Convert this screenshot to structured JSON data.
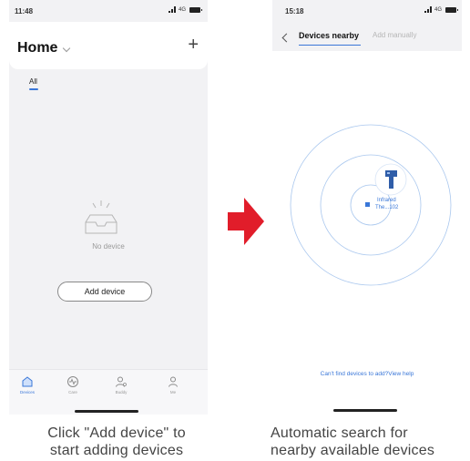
{
  "left_screen": {
    "status_bar": {
      "time": "11:48",
      "network": "4G"
    },
    "header": {
      "title": "Home",
      "add_label": "+"
    },
    "tabs": [
      {
        "label": "All"
      }
    ],
    "empty_state": {
      "text": "No device"
    },
    "add_button": {
      "label": "Add device"
    },
    "bottom_nav": [
      {
        "label": "Devices",
        "icon": "house-icon",
        "active": true
      },
      {
        "label": "Care",
        "icon": "wave-icon",
        "active": false
      },
      {
        "label": "Buddy",
        "icon": "buddy-icon",
        "active": false
      },
      {
        "label": "Me",
        "icon": "person-icon",
        "active": false
      }
    ]
  },
  "right_screen": {
    "status_bar": {
      "time": "15:18",
      "network": "4G"
    },
    "tabs": {
      "active": "Devices nearby",
      "inactive": "Add manually"
    },
    "found_device": {
      "name_line1": "Infrared",
      "name_line2": "The...102"
    },
    "help_text": "Can't find devices to add?View help"
  },
  "arrow": {
    "color": "#e11d2a"
  },
  "captions": {
    "left_line1": "Click \"Add device\" to",
    "left_line2": "start adding devices",
    "right_line1": "Automatic search for",
    "right_line2": "nearby available devices"
  },
  "colors": {
    "accent": "#3a77d8"
  }
}
